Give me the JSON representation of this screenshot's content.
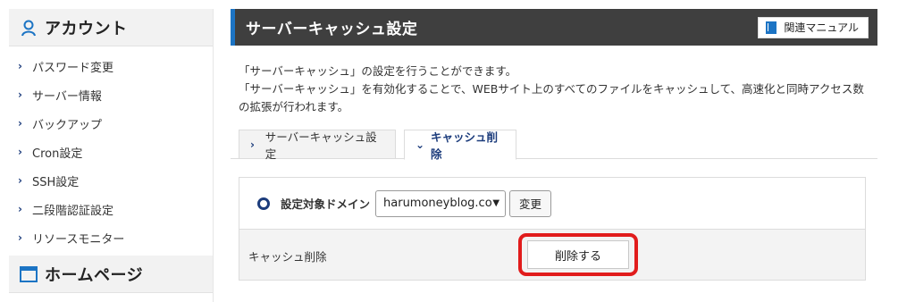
{
  "sidebar": {
    "account_title": "アカウント",
    "account_icon": "user-icon",
    "items": [
      {
        "label": "パスワード変更"
      },
      {
        "label": "サーバー情報"
      },
      {
        "label": "バックアップ"
      },
      {
        "label": "Cron設定"
      },
      {
        "label": "SSH設定"
      },
      {
        "label": "二段階認証設定"
      },
      {
        "label": "リソースモニター"
      }
    ],
    "home_title": "ホームページ",
    "home_icon": "window-icon"
  },
  "header": {
    "title": "サーバーキャッシュ設定",
    "manual_button": "関連マニュアル",
    "manual_icon": "book-icon"
  },
  "description": {
    "line1": "「サーバーキャッシュ」の設定を行うことができます。",
    "line2": "「サーバーキャッシュ」を有効化することで、WEBサイト上のすべてのファイルをキャッシュして、高速化と同時アクセス数の拡張が行われます。"
  },
  "tabs": [
    {
      "label": "サーバーキャッシュ設定",
      "active": false
    },
    {
      "label": "キャッシュ削除",
      "active": true
    }
  ],
  "panel": {
    "domain_label": "設定対象ドメイン",
    "domain_value": "harumoneyblog.co",
    "change_button": "変更",
    "cache_delete_label": "キャッシュ削除",
    "delete_button": "削除する"
  },
  "colors": {
    "accent": "#1c74c4",
    "navy": "#1c3c7c",
    "header_bg": "#3f3f3f",
    "highlight": "#e11c1c"
  }
}
